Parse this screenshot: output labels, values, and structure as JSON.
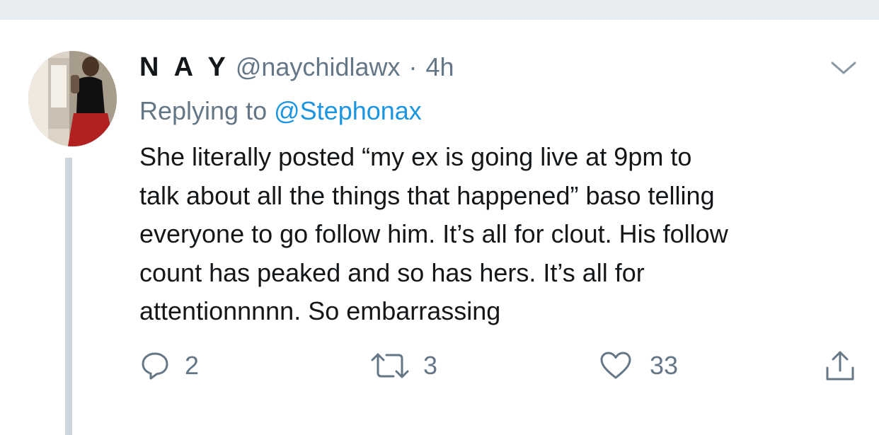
{
  "tweet": {
    "display_name": "N A Y",
    "handle": "@naychidlawx",
    "separator": "·",
    "time": "4h",
    "replying_prefix": "Replying to ",
    "replying_to": "@Stephonax",
    "text_lines": [
      "She literally posted “my ex is going live at 9pm to",
      "talk about all the things that happened” baso telling",
      "everyone to go follow him. It’s all for clout. His follow",
      "count has peaked and so has hers. It’s all for",
      "attentionnnnn. So embarrassing"
    ]
  },
  "actions": {
    "reply": {
      "icon": "reply-bubble-icon",
      "count": "2"
    },
    "retweet": {
      "icon": "retweet-icon",
      "count": "3"
    },
    "like": {
      "icon": "heart-icon",
      "count": "33"
    },
    "share": {
      "icon": "share-icon"
    }
  },
  "colors": {
    "text_primary": "#14171a",
    "text_secondary": "#657786",
    "link": "#1b95e0",
    "thread_line": "#ccd6dd",
    "top_bar": "#e6ecf0"
  }
}
